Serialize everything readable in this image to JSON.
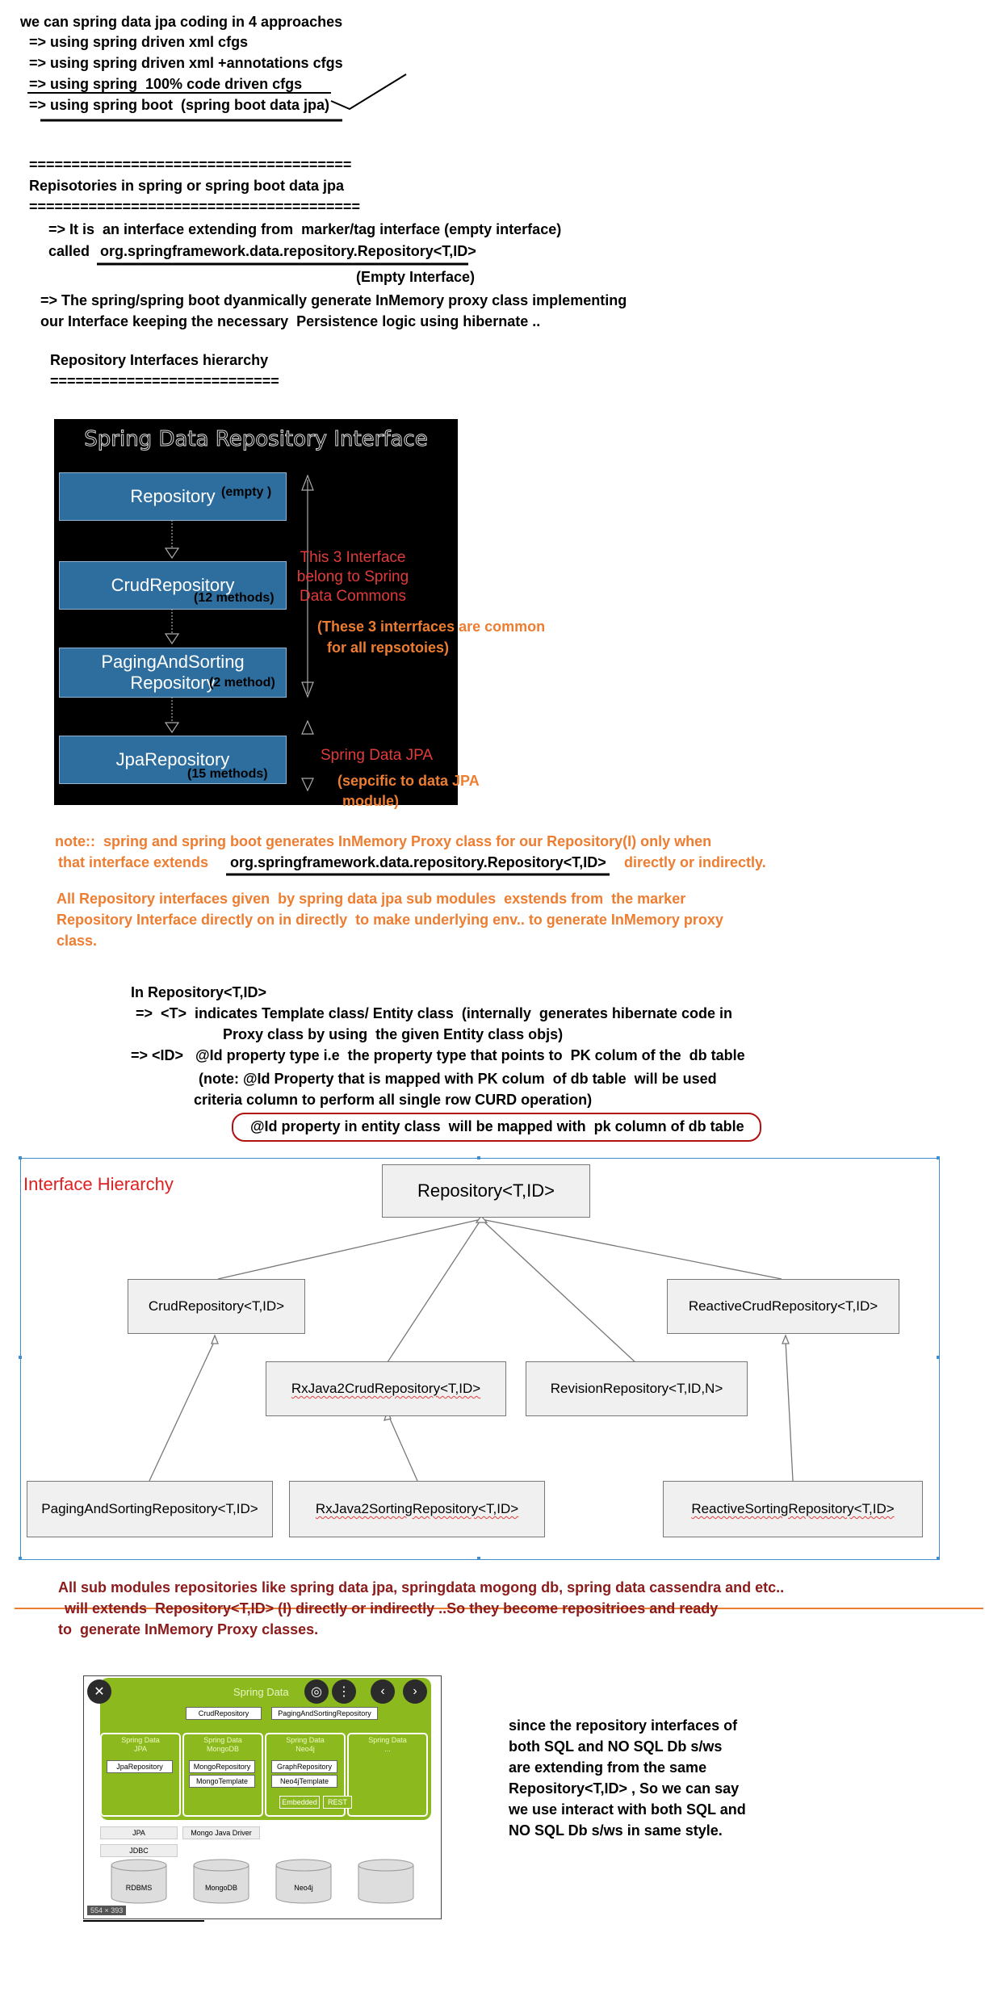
{
  "intro": {
    "l1": "we can spring data jpa coding in 4 approaches",
    "l2": "=> using spring driven xml cfgs",
    "l3": "=> using spring driven xml +annotations cfgs",
    "l4": "=> using spring  100% code driven cfgs",
    "l5": "=> using spring boot  (spring boot data jpa)"
  },
  "repositories": {
    "rule": "======================================",
    "title": "Repisotories in spring or spring boot data jpa",
    "rule2": "=======================================",
    "p1a": "=> It is  an interface extending from  marker/tag interface (empty interface)",
    "p1b": "called",
    "p1c": "org.springframework.data.repository.Repository<T,ID>",
    "p1d": "(Empty Interface)",
    "p2a": "=> The spring/spring boot dyanmically generate InMemory proxy class implementing",
    "p2b": "our Interface keeping the necessary  Persistence logic using hibernate ..",
    "hier_title": "Repository Interfaces hierarchy",
    "hier_rule": "==========================="
  },
  "diagram": {
    "title": "Spring Data Repository Interface",
    "box1": "Repository",
    "box1_note": "(empty )",
    "box2": "CrudRepository",
    "box2_note": "(12 methods)",
    "box3a": "PagingAndSorting",
    "box3b": "Repository",
    "box3_note": "(2 method)",
    "box4": "JpaRepository",
    "box4_note": "(15 methods)",
    "commons_a": "This 3 Interface",
    "commons_b": "belong to Spring",
    "commons_c": "Data Commons",
    "common_note_a": "(These 3 interrfaces are common",
    "common_note_b": "for all repsotoies)",
    "jpa_label": "Spring Data JPA",
    "jpa_note_a": "(sepcific to data JPA",
    "jpa_note_b": "module)"
  },
  "notes": {
    "n1a": "note::  spring and spring boot generates InMemory Proxy class for our Repository(I) only when",
    "n1b": "that interface extends",
    "n1c": "org.springframework.data.repository.Repository<T,ID>",
    "n1d": "directly or indirectly.",
    "n2a": "All Repository interfaces given  by spring data jpa sub modules  exstends from  the marker",
    "n2b": "Repository Interface directly on in directly  to make underlying env.. to generate InMemory proxy",
    "n2c": "class."
  },
  "generics": {
    "g1": "In Repository<T,ID>",
    "g2": "=>  <T>  indicates Template class/ Entity class  (internally  generates hibernate code in",
    "g3": "Proxy class by using  the given Entity class objs)",
    "g4": "=> <ID>   @Id property type i.e  the property type that points to  PK colum of the  db table",
    "g5": "(note: @Id Property that is mapped with PK colum  of db table  will be used",
    "g6": "criteria column to perform all single row CURD operation)",
    "g7": "@Id property in entity class  will be mapped with  pk column of db table"
  },
  "hierarchy": {
    "title": "Interface Hierarchy",
    "repo": "Repository<T,ID>",
    "crud": "CrudRepository<T,ID>",
    "reactive_crud": "ReactiveCrudRepository<T,ID>",
    "rx_crud": "RxJava2CrudRepository<T,ID>",
    "revision": "RevisionRepository<T,ID,N>",
    "paging": "PagingAndSortingRepository<T,ID>",
    "rx_sorting": "RxJava2SortingRepository<T,ID>",
    "reactive_sorting": "ReactiveSortingRepository<T,ID>"
  },
  "submodules": {
    "s1": "All sub modules repositories like spring data jpa, springdata mogong db, spring data cassendra and etc..",
    "s2": "will extends  Repository<T,ID> (I) directly or indirectly ..So they become repositrioes and ready",
    "s3": "to  generate InMemory Proxy classes."
  },
  "spring_data_image": {
    "title": "Spring Data",
    "crud": "CrudRepository",
    "paging": "PagingAndSortingRepository",
    "col1_h": "Spring Data\nJPA",
    "col1_a": "JpaRepository",
    "col2_h": "Spring Data\nMongoDB",
    "col2_a": "MongoRepository",
    "col2_b": "MongoTemplate",
    "col3_h": "Spring Data\nNeo4j",
    "col3_a": "GraphRepository",
    "col3_b": "Neo4jTemplate",
    "col4_h": "Spring Data\n...",
    "embedded": "Embedded",
    "rest": "REST",
    "jpa": "JPA",
    "mongo_driver": "Mongo Java Driver",
    "jdbc": "JDBC",
    "db1": "RDBMS",
    "db2": "MongoDB",
    "db3": "Neo4j",
    "size": "554 × 393"
  },
  "since": {
    "t1": "since  the repository interfaces of",
    "t2": "both SQL and NO SQL Db s/ws",
    "t3": "are extending from  the same",
    "t4": "Repository<T,ID> , So we can say",
    "t5": "we use interact with both SQL and",
    "t6": "NO SQL Db s/ws  in same style."
  }
}
